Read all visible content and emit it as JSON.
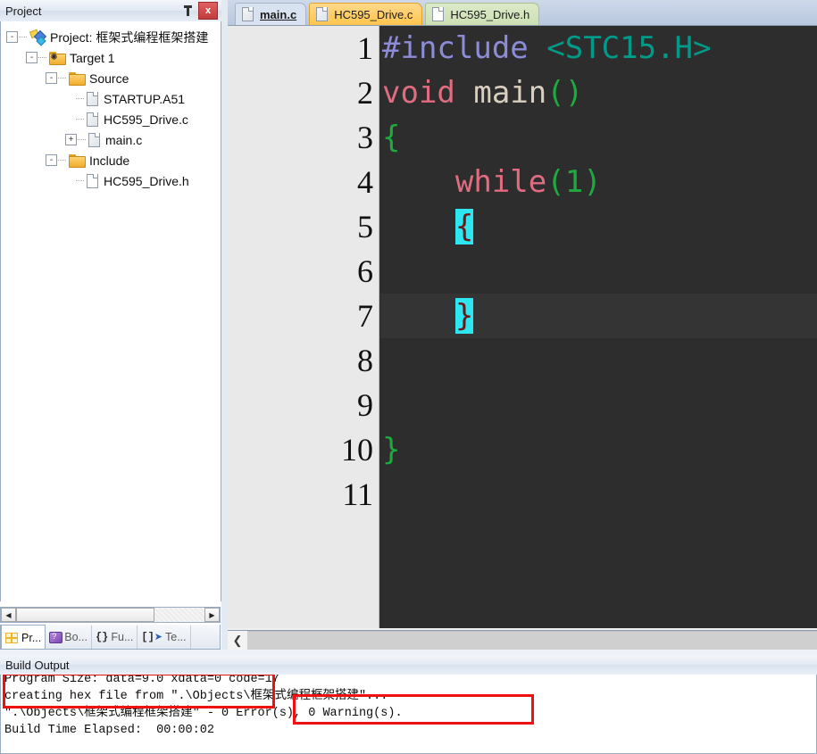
{
  "project_pane": {
    "title": "Project",
    "pin_icon": "pin-icon",
    "close_label": "x",
    "tree": [
      {
        "level": 0,
        "expander": "-",
        "icon": "project-icon",
        "label": "Project: 框架式编程框架搭建"
      },
      {
        "level": 1,
        "expander": "-",
        "icon": "target-folder-icon",
        "label": "Target 1"
      },
      {
        "level": 2,
        "expander": "-",
        "icon": "folder-icon",
        "label": "Source"
      },
      {
        "level": 3,
        "expander": "",
        "icon": "file-icon",
        "label": "STARTUP.A51"
      },
      {
        "level": 3,
        "expander": "",
        "icon": "file-icon",
        "label": "HC595_Drive.c"
      },
      {
        "level": 3,
        "expander": "+",
        "icon": "file-icon",
        "label": "main.c"
      },
      {
        "level": 2,
        "expander": "-",
        "icon": "folder-icon",
        "label": "Include"
      },
      {
        "level": 3,
        "expander": "",
        "icon": "file-white-icon",
        "label": "HC595_Drive.h"
      }
    ],
    "scrollbar": {
      "left_arrow": "◀",
      "right_arrow": "▶"
    },
    "tabs": [
      {
        "label": "Pr...",
        "icon": "project-tab-icon",
        "active": true
      },
      {
        "label": "Bo...",
        "icon": "books-tab-icon",
        "active": false
      },
      {
        "label": "Fu...",
        "icon": "functions-tab-icon",
        "active": false
      },
      {
        "label": "Te...",
        "icon": "templates-tab-icon",
        "active": false
      }
    ]
  },
  "editor": {
    "tabs": [
      {
        "label": "main.c",
        "style": "t-main",
        "active": true
      },
      {
        "label": "HC595_Drive.c",
        "style": "t-c",
        "active": false
      },
      {
        "label": "HC595_Drive.h",
        "style": "t-h",
        "active": false
      }
    ],
    "line_numbers": [
      "1",
      "2",
      "3",
      "4",
      "5",
      "6",
      "7",
      "8",
      "9",
      "10",
      "11"
    ],
    "lines": [
      {
        "n": "1",
        "current": false,
        "tokens": [
          {
            "t": "#include",
            "c": "k-pre"
          },
          {
            "t": " ",
            "c": ""
          },
          {
            "t": "<STC15.H>",
            "c": "k-inc"
          }
        ]
      },
      {
        "n": "2",
        "current": false,
        "tokens": [
          {
            "t": "void",
            "c": "k-kw"
          },
          {
            "t": " ",
            "c": ""
          },
          {
            "t": "main",
            "c": "k-fn"
          },
          {
            "t": "()",
            "c": "k-paren"
          }
        ]
      },
      {
        "n": "3",
        "current": false,
        "tokens": [
          {
            "t": "{",
            "c": "k-brace"
          }
        ]
      },
      {
        "n": "4",
        "current": false,
        "tokens": [
          {
            "t": "    ",
            "c": ""
          },
          {
            "t": "while",
            "c": "k-kw"
          },
          {
            "t": "(",
            "c": "k-paren"
          },
          {
            "t": "1",
            "c": "k-num"
          },
          {
            "t": ")",
            "c": "k-paren"
          }
        ]
      },
      {
        "n": "5",
        "current": false,
        "tokens": [
          {
            "t": "    ",
            "c": ""
          },
          {
            "t": "{",
            "c": "k-hl"
          }
        ]
      },
      {
        "n": "6",
        "current": false,
        "tokens": []
      },
      {
        "n": "7",
        "current": true,
        "tokens": [
          {
            "t": "    ",
            "c": ""
          },
          {
            "t": "}",
            "c": "k-hl"
          }
        ]
      },
      {
        "n": "8",
        "current": false,
        "tokens": []
      },
      {
        "n": "9",
        "current": false,
        "tokens": []
      },
      {
        "n": "10",
        "current": false,
        "tokens": [
          {
            "t": "}",
            "c": "k-brace"
          }
        ]
      },
      {
        "n": "11",
        "current": false,
        "tokens": []
      }
    ],
    "scroll_left_arrow": "❮"
  },
  "build_output": {
    "title": "Build Output",
    "lines": [
      "Program Size: data=9.0 xdata=0 code=17",
      "creating hex file from \".\\Objects\\框架式编程框架搭建\"...",
      "\".\\Objects\\框架式编程框架搭建\" - 0 Error(s), 0 Warning(s).",
      "Build Time Elapsed:  00:00:02"
    ],
    "annotation_color": "#f01010"
  }
}
